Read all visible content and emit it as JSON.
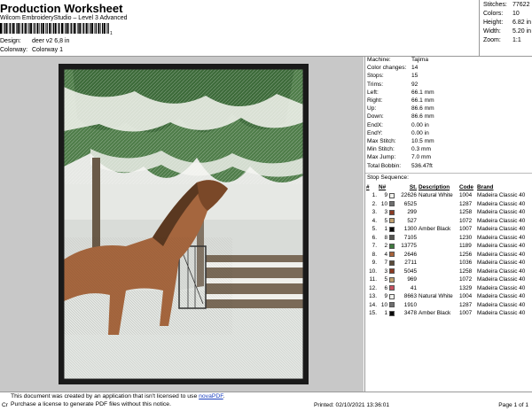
{
  "header": {
    "title": "Production Worksheet",
    "subtitle": "Wilcom EmbroideryStudio – Level 3 Advanced",
    "barcode_number": "1",
    "design_label": "Design:",
    "design_value": "deer v2 6,8 in",
    "colorway_label": "Colorway:",
    "colorway_value": "Colorway 1"
  },
  "stats": [
    {
      "label": "Stitches:",
      "value": "77622"
    },
    {
      "label": "Colors:",
      "value": "10"
    },
    {
      "label": "Height:",
      "value": "6.82 in"
    },
    {
      "label": "Width:",
      "value": "5.20 in"
    },
    {
      "label": "Zoom:",
      "value": "1:1"
    }
  ],
  "machine_info": [
    {
      "label": "Machine:",
      "value": "Tajima"
    },
    {
      "label": "Color changes:",
      "value": "14"
    },
    {
      "label": "Stops:",
      "value": "15"
    },
    {
      "label": "Trims:",
      "value": "92"
    },
    {
      "label": "Left:",
      "value": "66.1 mm"
    },
    {
      "label": "Right:",
      "value": "66.1 mm"
    },
    {
      "label": "Up:",
      "value": "86.6 mm"
    },
    {
      "label": "Down:",
      "value": "86.6 mm"
    },
    {
      "label": "EndX:",
      "value": "0.00 in"
    },
    {
      "label": "EndY:",
      "value": "0.00 in"
    },
    {
      "label": "Max Stitch:",
      "value": "10.5 mm"
    },
    {
      "label": "Min Stitch:",
      "value": "0.3 mm"
    },
    {
      "label": "Max Jump:",
      "value": "7.0 mm"
    },
    {
      "label": "Total Bobbin:",
      "value": "536.47ft"
    }
  ],
  "stop_sequence": {
    "title": "Stop Sequence:",
    "headers": [
      "#",
      "N#",
      "St.",
      "Description",
      "Code",
      "Brand"
    ],
    "rows": [
      {
        "n": "1.",
        "nn": "9",
        "color": "#f2f2ee",
        "st": "22626",
        "desc": "Natural White",
        "code": "1004",
        "brand": "Madeira Classic 40"
      },
      {
        "n": "2.",
        "nn": "10",
        "color": "#6e6e6e",
        "st": "6525",
        "desc": "",
        "code": "1287",
        "brand": "Madeira Classic 40"
      },
      {
        "n": "3.",
        "nn": "3",
        "color": "#8a3a22",
        "st": "299",
        "desc": "",
        "code": "1258",
        "brand": "Madeira Classic 40"
      },
      {
        "n": "4.",
        "nn": "5",
        "color": "#c0a070",
        "st": "527",
        "desc": "",
        "code": "1072",
        "brand": "Madeira Classic 40"
      },
      {
        "n": "5.",
        "nn": "1",
        "color": "#0a0a0a",
        "st": "1300",
        "desc": "Amber Black",
        "code": "1007",
        "brand": "Madeira Classic 40"
      },
      {
        "n": "6.",
        "nn": "8",
        "color": "#555550",
        "st": "7105",
        "desc": "",
        "code": "1230",
        "brand": "Madeira Classic 40"
      },
      {
        "n": "7.",
        "nn": "2",
        "color": "#3e7a3e",
        "st": "13775",
        "desc": "",
        "code": "1189",
        "brand": "Madeira Classic 40"
      },
      {
        "n": "8.",
        "nn": "4",
        "color": "#a8623a",
        "st": "2646",
        "desc": "",
        "code": "1256",
        "brand": "Madeira Classic 40"
      },
      {
        "n": "9.",
        "nn": "7",
        "color": "#5a4a38",
        "st": "2711",
        "desc": "",
        "code": "1036",
        "brand": "Madeira Classic 40"
      },
      {
        "n": "10.",
        "nn": "3",
        "color": "#8a3a22",
        "st": "5045",
        "desc": "",
        "code": "1258",
        "brand": "Madeira Classic 40"
      },
      {
        "n": "11.",
        "nn": "5",
        "color": "#c0a070",
        "st": "969",
        "desc": "",
        "code": "1072",
        "brand": "Madeira Classic 40"
      },
      {
        "n": "12.",
        "nn": "6",
        "color": "#c85060",
        "st": "41",
        "desc": "",
        "code": "1329",
        "brand": "Madeira Classic 40"
      },
      {
        "n": "13.",
        "nn": "9",
        "color": "#f2f2ee",
        "st": "8663",
        "desc": "Natural White",
        "code": "1004",
        "brand": "Madeira Classic 40"
      },
      {
        "n": "14.",
        "nn": "10",
        "color": "#6e6e6e",
        "st": "1910",
        "desc": "",
        "code": "1287",
        "brand": "Madeira Classic 40"
      },
      {
        "n": "15.",
        "nn": "1",
        "color": "#0a0a0a",
        "st": "3478",
        "desc": "Amber Black",
        "code": "1007",
        "brand": "Madeira Classic 40"
      }
    ]
  },
  "footer": {
    "notice_line1": "This document was created by an application that isn't licensed to use ",
    "notice_link": "novaPDF",
    "notice_line2": "Purchase a license to generate PDF files without this notice.",
    "cr": "Cr",
    "printed": "Printed: 02/10/2021 13:36:01",
    "page": "Page 1 of 1"
  }
}
